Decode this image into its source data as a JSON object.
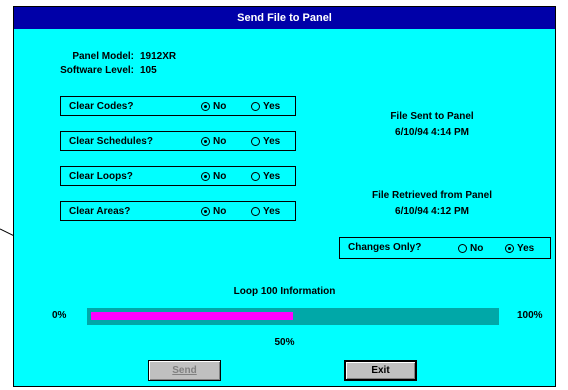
{
  "window": {
    "title": "Send File to Panel"
  },
  "panel_info": {
    "model_label": "Panel Model:",
    "model_value": "1912XR",
    "software_label": "Software Level:",
    "software_value": "105"
  },
  "options": [
    {
      "label": "Clear Codes?",
      "no": "No",
      "yes": "Yes",
      "selected": "No"
    },
    {
      "label": "Clear Schedules?",
      "no": "No",
      "yes": "Yes",
      "selected": "No"
    },
    {
      "label": "Clear Loops?",
      "no": "No",
      "yes": "Yes",
      "selected": "No"
    },
    {
      "label": "Clear Areas?",
      "no": "No",
      "yes": "Yes",
      "selected": "No"
    }
  ],
  "status": {
    "sent_label": "File Sent to Panel",
    "sent_time": "6/10/94 4:14 PM",
    "retrieved_label": "File Retrieved from Panel",
    "retrieved_time": "6/10/94 4:12 PM"
  },
  "changes_only": {
    "label": "Changes Only?",
    "no": "No",
    "yes": "Yes",
    "selected": "Yes"
  },
  "progress": {
    "title": "Loop 100 Information",
    "min_label": "0%",
    "max_label": "100%",
    "value_label": "50%",
    "value": 0.5
  },
  "buttons": {
    "send": "Send",
    "exit": "Exit"
  },
  "colors": {
    "background": "#00ffff",
    "title_bar": "#0000a8",
    "progress_fill": "#ff00ff",
    "progress_track": "#00a8a8"
  }
}
